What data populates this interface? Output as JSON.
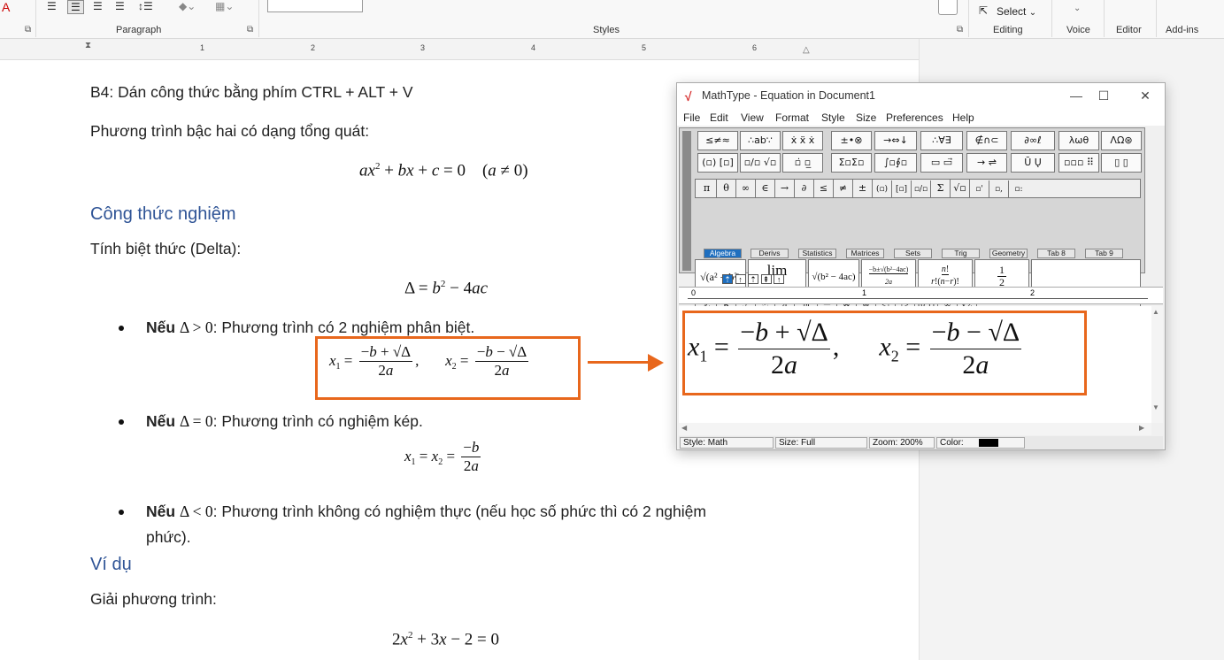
{
  "ribbon": {
    "groups": {
      "paragraph": "Paragraph",
      "styles": "Styles",
      "editing": "Editing",
      "voice": "Voice",
      "editor": "Editor",
      "addins": "Add-ins"
    },
    "select_label": "Select",
    "select_caret": "⌄"
  },
  "ruler": {
    "numbers": [
      "1",
      "2",
      "3",
      "4",
      "5",
      "6"
    ]
  },
  "document": {
    "step4": "B4: Dán công thức bằng phím CTRL + ALT + V",
    "general_form_intro": "Phương trình bậc hai có dạng tổng quát:",
    "heading_formula": "Công thức nghiệm",
    "delta_intro": "Tính biệt thức (Delta):",
    "case1_bold": "Nếu",
    "case1_text": ": Phương trình có 2 nghiệm phân biệt.",
    "case2_bold": "Nếu",
    "case2_text": ": Phương trình có nghiệm kép.",
    "case3_bold": "Nếu",
    "case3_text": ": Phương trình không có nghiệm thực (nếu học số phức thì có 2 nghiệm",
    "case3_cont": "phức).",
    "heading_example": "Ví dụ",
    "solve_intro": "Giải phương trình:"
  },
  "mathtype": {
    "title": "MathType - Equation in Document1",
    "menu": [
      "File",
      "Edit",
      "View",
      "Format",
      "Style",
      "Size",
      "Preferences",
      "Help"
    ],
    "tabs": [
      "Algebra",
      "Derivs",
      "Statistics",
      "Matrices",
      "Sets",
      "Trig",
      "Geometry",
      "Tab 8",
      "Tab 9"
    ],
    "active_tab": "Algebra",
    "ruler_numbers": [
      "0",
      "1",
      "2"
    ],
    "status": {
      "style": "Style: Math",
      "size": "Size: Full",
      "zoom": "Zoom: 200%",
      "color": "Color:"
    }
  }
}
